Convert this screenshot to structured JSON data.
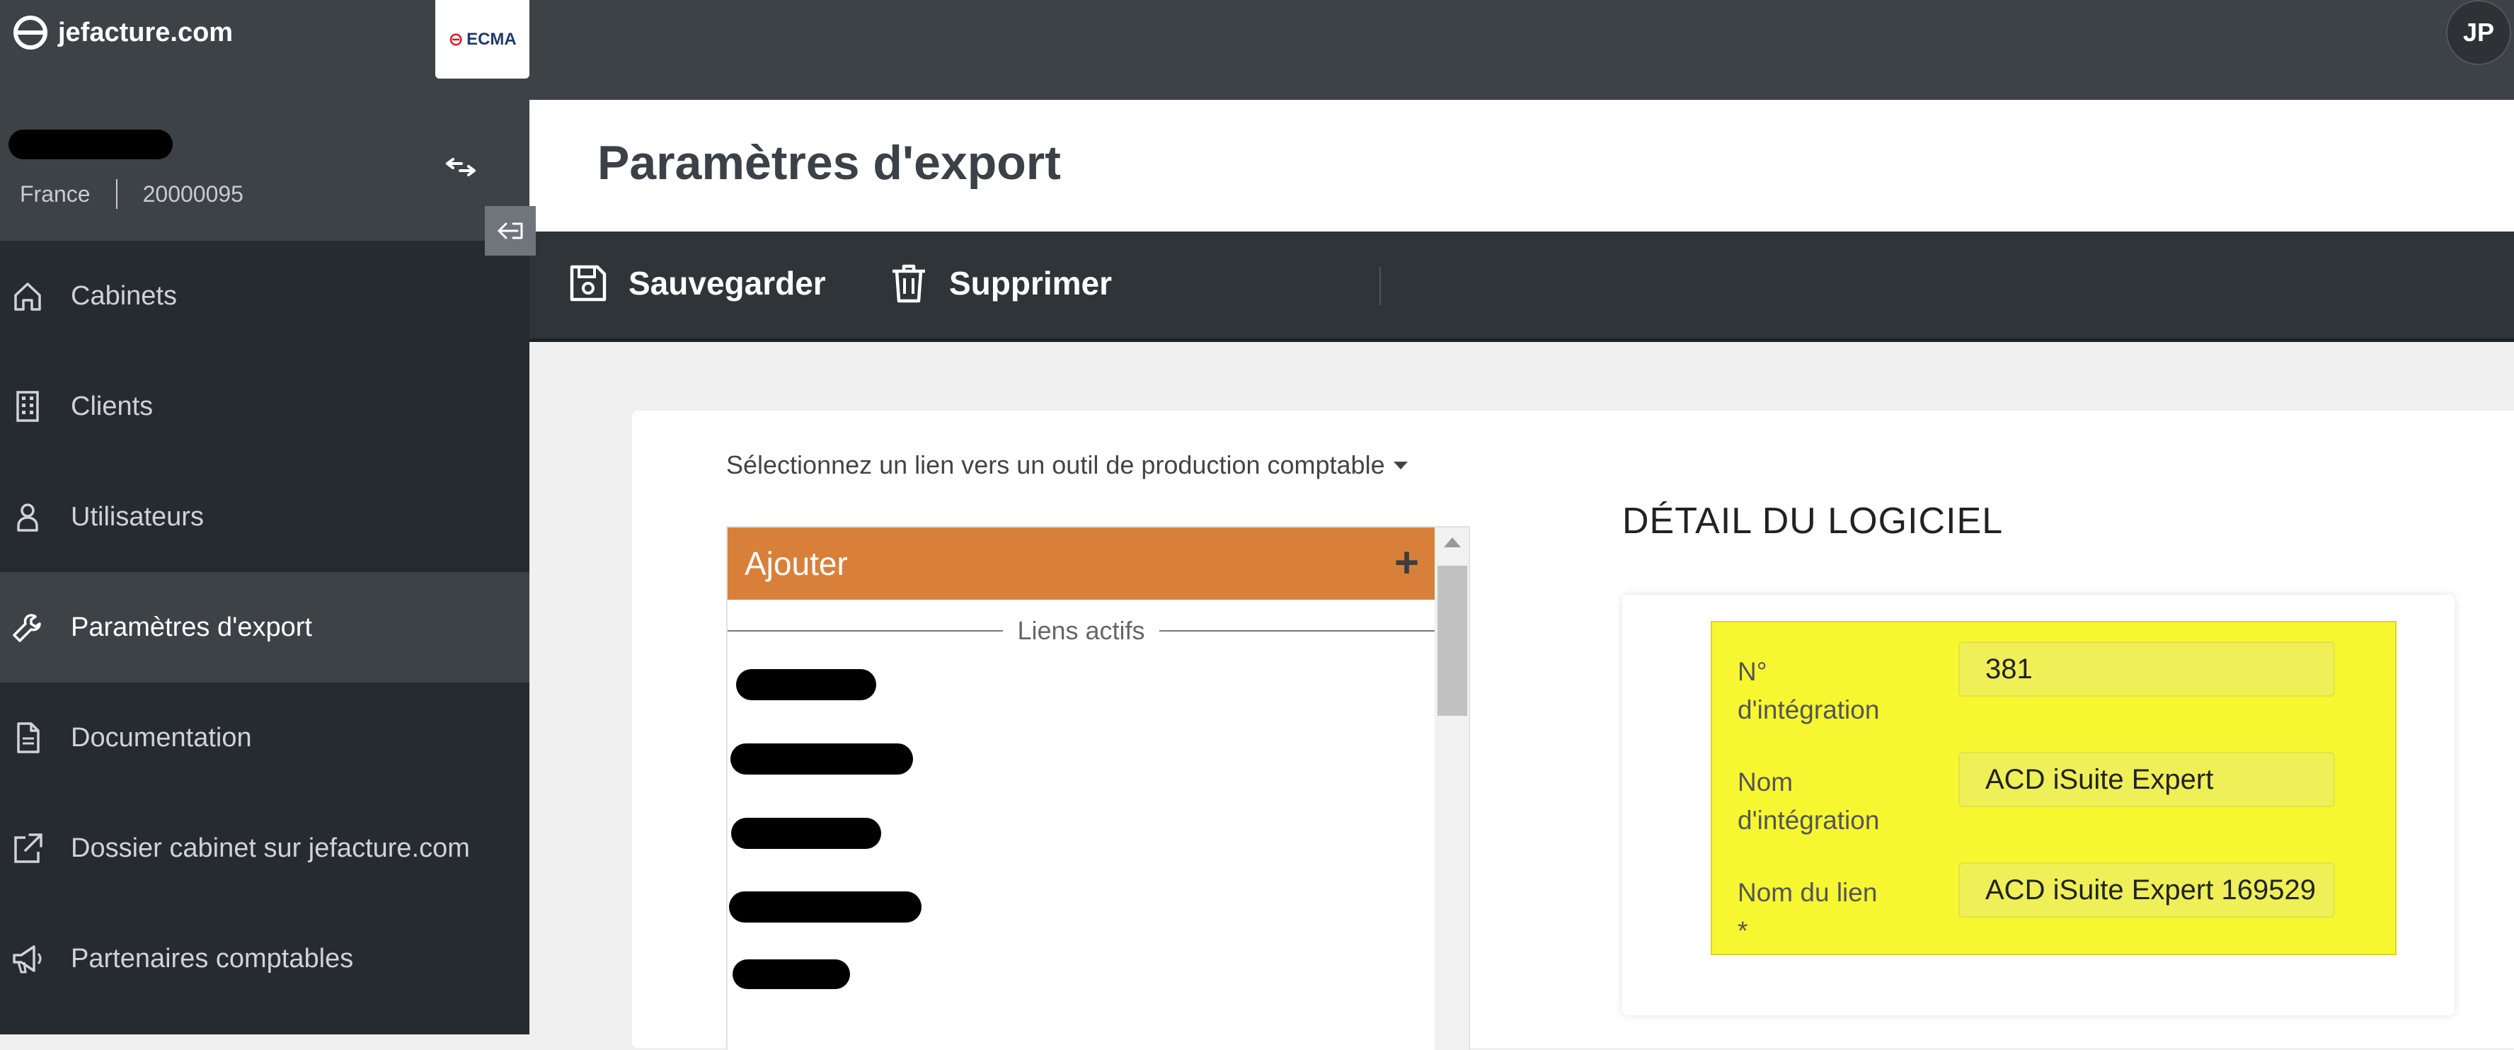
{
  "topbar": {
    "brand": "jefacture.com",
    "partner_logo": "ECMA",
    "avatar_initials": "JP"
  },
  "account": {
    "country": "France",
    "id": "20000095"
  },
  "sidebar": {
    "items": [
      {
        "label": "Cabinets",
        "icon": "home-icon"
      },
      {
        "label": "Clients",
        "icon": "building-icon"
      },
      {
        "label": "Utilisateurs",
        "icon": "user-icon"
      },
      {
        "label": "Paramètres d'export",
        "icon": "wrench-icon",
        "active": true
      },
      {
        "label": "Documentation",
        "icon": "document-icon"
      },
      {
        "label": "Dossier cabinet sur jefacture.com",
        "icon": "external-link-icon"
      },
      {
        "label": "Partenaires comptables",
        "icon": "megaphone-icon"
      }
    ]
  },
  "page": {
    "title": "Paramètres d'export"
  },
  "toolbar": {
    "save_label": "Sauvegarder",
    "delete_label": "Supprimer"
  },
  "link_selector": {
    "label": "Sélectionnez un lien vers un outil de production comptable"
  },
  "links_list": {
    "add_label": "Ajouter",
    "add_symbol": "+",
    "section_label": "Liens actifs"
  },
  "detail": {
    "title": "DÉTAIL DU LOGICIEL",
    "fields": [
      {
        "label_line1": "N°",
        "label_line2": "d'intégration",
        "value": "381"
      },
      {
        "label_line1": "Nom",
        "label_line2": "d'intégration",
        "value": "ACD iSuite Expert"
      },
      {
        "label_line1": "Nom du lien",
        "label_line2": "*",
        "value": "ACD iSuite Expert 169529"
      }
    ]
  },
  "colors": {
    "topbar": "#3d4247",
    "sidebar": "#262b2f",
    "add_button": "#d8803a",
    "highlight": "#f7f731"
  }
}
